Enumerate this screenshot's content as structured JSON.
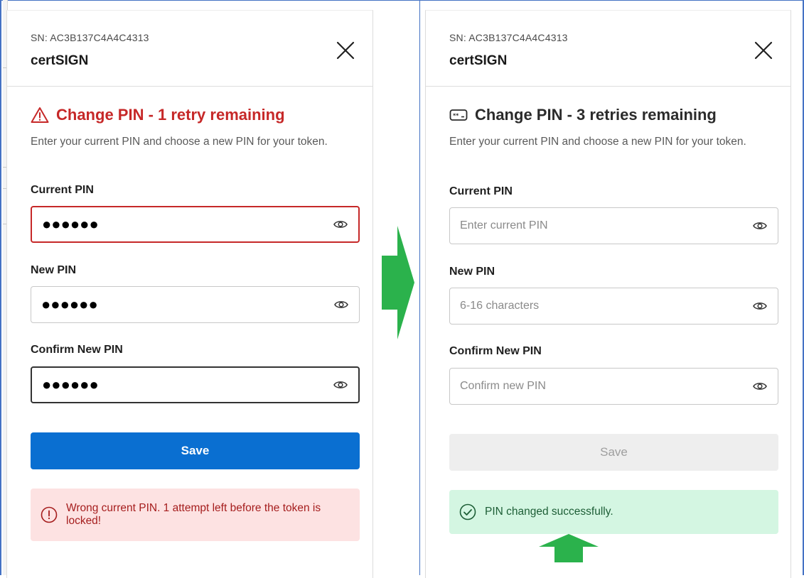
{
  "colors": {
    "error": "#c62828",
    "primary": "#0a6fd1",
    "success_bg": "#d4f6e2",
    "error_bg": "#fde2e2",
    "arrow": "#2bb24c"
  },
  "left_panel": {
    "serial": "SN: AC3B137C4A4C4313",
    "brand": "certSIGN",
    "title": "Change PIN - 1 retry remaining",
    "title_icon": "warning-triangle-icon",
    "subtitle": "Enter your current PIN and choose a new PIN for your token.",
    "fields": [
      {
        "label": "Current PIN",
        "value": "●●●●●●",
        "state": "error"
      },
      {
        "label": "New PIN",
        "value": "●●●●●●",
        "state": "normal"
      },
      {
        "label": "Confirm New PIN",
        "value": "●●●●●●",
        "state": "focused"
      }
    ],
    "save_label": "Save",
    "alert": {
      "icon": "error-circle-icon",
      "text": "Wrong current PIN. 1 attempt left before the token is locked!"
    }
  },
  "right_panel": {
    "serial": "SN: AC3B137C4A4C4313",
    "brand": "certSIGN",
    "title": "Change PIN - 3 retries remaining",
    "title_icon": "password-field-icon",
    "subtitle": "Enter your current PIN and choose a new PIN for your token.",
    "fields": [
      {
        "label": "Current PIN",
        "placeholder": "Enter current PIN"
      },
      {
        "label": "New PIN",
        "placeholder": "6-16 characters"
      },
      {
        "label": "Confirm New PIN",
        "placeholder": "Confirm new PIN"
      }
    ],
    "save_label": "Save",
    "alert": {
      "icon": "check-circle-icon",
      "text": "PIN changed successfully."
    }
  }
}
